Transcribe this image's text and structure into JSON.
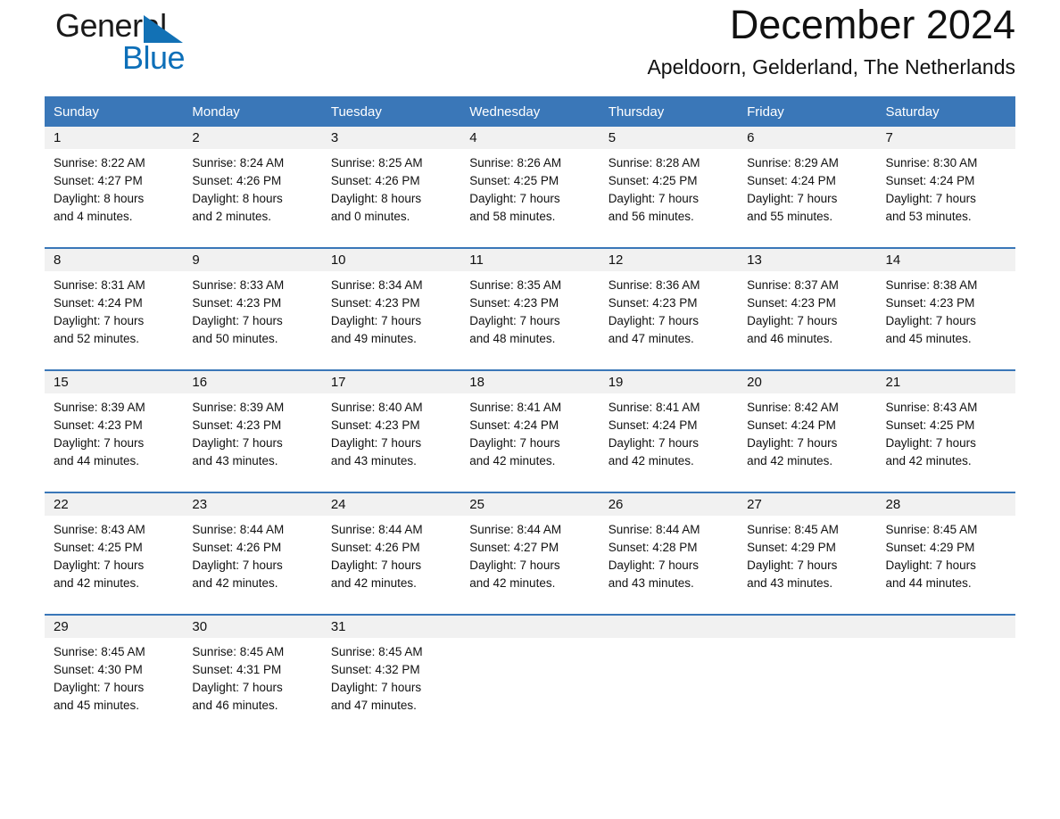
{
  "brand": {
    "line1": "General",
    "line2": "Blue",
    "triangle_color": "#1271b5",
    "blue_text_color": "#0d6fb8"
  },
  "header": {
    "month_title": "December 2024",
    "location": "Apeldoorn, Gelderland, The Netherlands"
  },
  "theme": {
    "header_blue": "#3a77b8",
    "daynum_bg": "#f1f1f1",
    "text": "#111111"
  },
  "weekday_headers": [
    "Sunday",
    "Monday",
    "Tuesday",
    "Wednesday",
    "Thursday",
    "Friday",
    "Saturday"
  ],
  "weeks": [
    [
      {
        "day": "1",
        "sunrise": "Sunrise: 8:22 AM",
        "sunset": "Sunset: 4:27 PM",
        "daylight1": "Daylight: 8 hours",
        "daylight2": "and 4 minutes."
      },
      {
        "day": "2",
        "sunrise": "Sunrise: 8:24 AM",
        "sunset": "Sunset: 4:26 PM",
        "daylight1": "Daylight: 8 hours",
        "daylight2": "and 2 minutes."
      },
      {
        "day": "3",
        "sunrise": "Sunrise: 8:25 AM",
        "sunset": "Sunset: 4:26 PM",
        "daylight1": "Daylight: 8 hours",
        "daylight2": "and 0 minutes."
      },
      {
        "day": "4",
        "sunrise": "Sunrise: 8:26 AM",
        "sunset": "Sunset: 4:25 PM",
        "daylight1": "Daylight: 7 hours",
        "daylight2": "and 58 minutes."
      },
      {
        "day": "5",
        "sunrise": "Sunrise: 8:28 AM",
        "sunset": "Sunset: 4:25 PM",
        "daylight1": "Daylight: 7 hours",
        "daylight2": "and 56 minutes."
      },
      {
        "day": "6",
        "sunrise": "Sunrise: 8:29 AM",
        "sunset": "Sunset: 4:24 PM",
        "daylight1": "Daylight: 7 hours",
        "daylight2": "and 55 minutes."
      },
      {
        "day": "7",
        "sunrise": "Sunrise: 8:30 AM",
        "sunset": "Sunset: 4:24 PM",
        "daylight1": "Daylight: 7 hours",
        "daylight2": "and 53 minutes."
      }
    ],
    [
      {
        "day": "8",
        "sunrise": "Sunrise: 8:31 AM",
        "sunset": "Sunset: 4:24 PM",
        "daylight1": "Daylight: 7 hours",
        "daylight2": "and 52 minutes."
      },
      {
        "day": "9",
        "sunrise": "Sunrise: 8:33 AM",
        "sunset": "Sunset: 4:23 PM",
        "daylight1": "Daylight: 7 hours",
        "daylight2": "and 50 minutes."
      },
      {
        "day": "10",
        "sunrise": "Sunrise: 8:34 AM",
        "sunset": "Sunset: 4:23 PM",
        "daylight1": "Daylight: 7 hours",
        "daylight2": "and 49 minutes."
      },
      {
        "day": "11",
        "sunrise": "Sunrise: 8:35 AM",
        "sunset": "Sunset: 4:23 PM",
        "daylight1": "Daylight: 7 hours",
        "daylight2": "and 48 minutes."
      },
      {
        "day": "12",
        "sunrise": "Sunrise: 8:36 AM",
        "sunset": "Sunset: 4:23 PM",
        "daylight1": "Daylight: 7 hours",
        "daylight2": "and 47 minutes."
      },
      {
        "day": "13",
        "sunrise": "Sunrise: 8:37 AM",
        "sunset": "Sunset: 4:23 PM",
        "daylight1": "Daylight: 7 hours",
        "daylight2": "and 46 minutes."
      },
      {
        "day": "14",
        "sunrise": "Sunrise: 8:38 AM",
        "sunset": "Sunset: 4:23 PM",
        "daylight1": "Daylight: 7 hours",
        "daylight2": "and 45 minutes."
      }
    ],
    [
      {
        "day": "15",
        "sunrise": "Sunrise: 8:39 AM",
        "sunset": "Sunset: 4:23 PM",
        "daylight1": "Daylight: 7 hours",
        "daylight2": "and 44 minutes."
      },
      {
        "day": "16",
        "sunrise": "Sunrise: 8:39 AM",
        "sunset": "Sunset: 4:23 PM",
        "daylight1": "Daylight: 7 hours",
        "daylight2": "and 43 minutes."
      },
      {
        "day": "17",
        "sunrise": "Sunrise: 8:40 AM",
        "sunset": "Sunset: 4:23 PM",
        "daylight1": "Daylight: 7 hours",
        "daylight2": "and 43 minutes."
      },
      {
        "day": "18",
        "sunrise": "Sunrise: 8:41 AM",
        "sunset": "Sunset: 4:24 PM",
        "daylight1": "Daylight: 7 hours",
        "daylight2": "and 42 minutes."
      },
      {
        "day": "19",
        "sunrise": "Sunrise: 8:41 AM",
        "sunset": "Sunset: 4:24 PM",
        "daylight1": "Daylight: 7 hours",
        "daylight2": "and 42 minutes."
      },
      {
        "day": "20",
        "sunrise": "Sunrise: 8:42 AM",
        "sunset": "Sunset: 4:24 PM",
        "daylight1": "Daylight: 7 hours",
        "daylight2": "and 42 minutes."
      },
      {
        "day": "21",
        "sunrise": "Sunrise: 8:43 AM",
        "sunset": "Sunset: 4:25 PM",
        "daylight1": "Daylight: 7 hours",
        "daylight2": "and 42 minutes."
      }
    ],
    [
      {
        "day": "22",
        "sunrise": "Sunrise: 8:43 AM",
        "sunset": "Sunset: 4:25 PM",
        "daylight1": "Daylight: 7 hours",
        "daylight2": "and 42 minutes."
      },
      {
        "day": "23",
        "sunrise": "Sunrise: 8:44 AM",
        "sunset": "Sunset: 4:26 PM",
        "daylight1": "Daylight: 7 hours",
        "daylight2": "and 42 minutes."
      },
      {
        "day": "24",
        "sunrise": "Sunrise: 8:44 AM",
        "sunset": "Sunset: 4:26 PM",
        "daylight1": "Daylight: 7 hours",
        "daylight2": "and 42 minutes."
      },
      {
        "day": "25",
        "sunrise": "Sunrise: 8:44 AM",
        "sunset": "Sunset: 4:27 PM",
        "daylight1": "Daylight: 7 hours",
        "daylight2": "and 42 minutes."
      },
      {
        "day": "26",
        "sunrise": "Sunrise: 8:44 AM",
        "sunset": "Sunset: 4:28 PM",
        "daylight1": "Daylight: 7 hours",
        "daylight2": "and 43 minutes."
      },
      {
        "day": "27",
        "sunrise": "Sunrise: 8:45 AM",
        "sunset": "Sunset: 4:29 PM",
        "daylight1": "Daylight: 7 hours",
        "daylight2": "and 43 minutes."
      },
      {
        "day": "28",
        "sunrise": "Sunrise: 8:45 AM",
        "sunset": "Sunset: 4:29 PM",
        "daylight1": "Daylight: 7 hours",
        "daylight2": "and 44 minutes."
      }
    ],
    [
      {
        "day": "29",
        "sunrise": "Sunrise: 8:45 AM",
        "sunset": "Sunset: 4:30 PM",
        "daylight1": "Daylight: 7 hours",
        "daylight2": "and 45 minutes."
      },
      {
        "day": "30",
        "sunrise": "Sunrise: 8:45 AM",
        "sunset": "Sunset: 4:31 PM",
        "daylight1": "Daylight: 7 hours",
        "daylight2": "and 46 minutes."
      },
      {
        "day": "31",
        "sunrise": "Sunrise: 8:45 AM",
        "sunset": "Sunset: 4:32 PM",
        "daylight1": "Daylight: 7 hours",
        "daylight2": "and 47 minutes."
      },
      {
        "day": "",
        "sunrise": "",
        "sunset": "",
        "daylight1": "",
        "daylight2": ""
      },
      {
        "day": "",
        "sunrise": "",
        "sunset": "",
        "daylight1": "",
        "daylight2": ""
      },
      {
        "day": "",
        "sunrise": "",
        "sunset": "",
        "daylight1": "",
        "daylight2": ""
      },
      {
        "day": "",
        "sunrise": "",
        "sunset": "",
        "daylight1": "",
        "daylight2": ""
      }
    ]
  ]
}
